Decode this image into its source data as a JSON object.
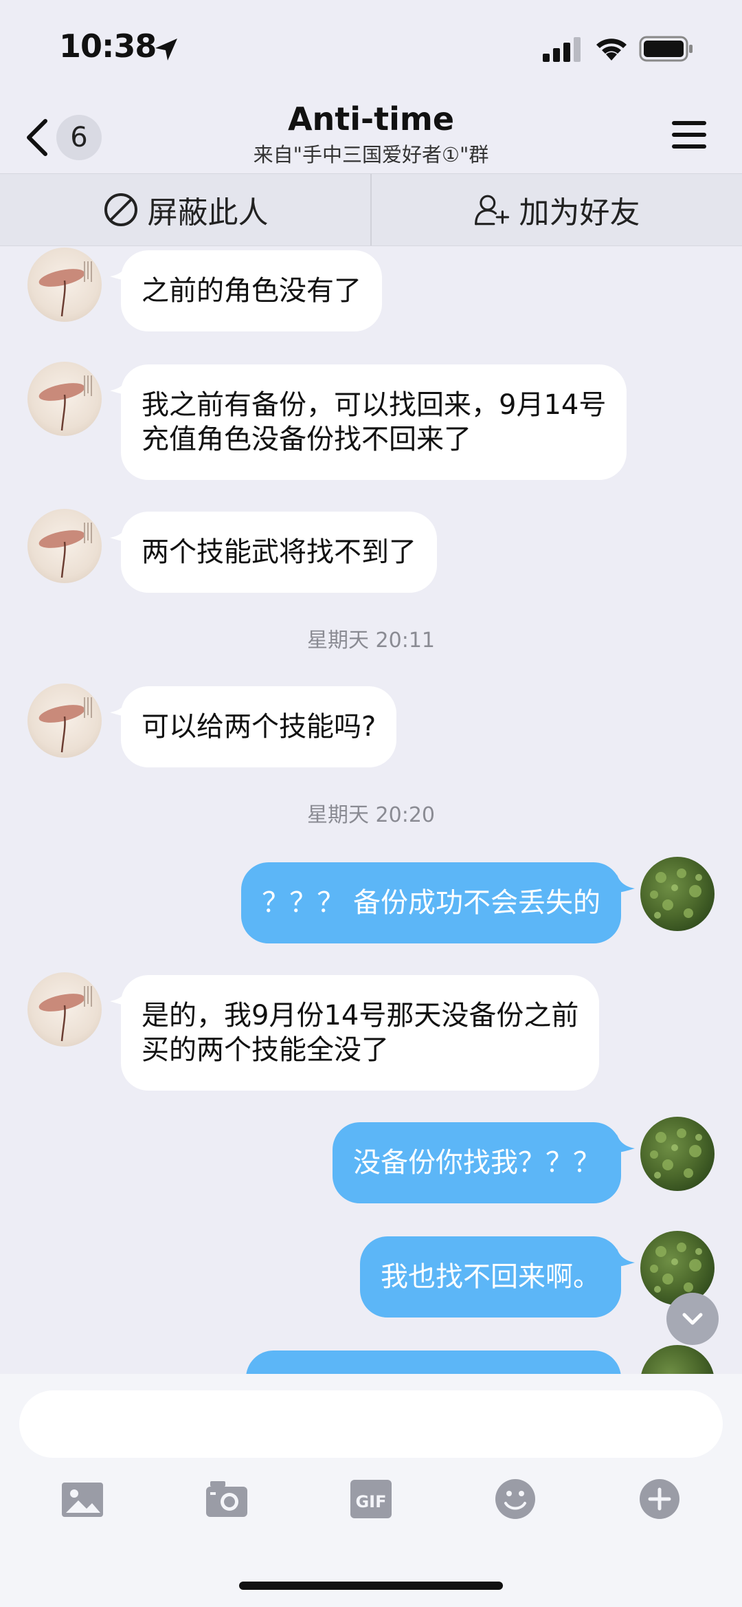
{
  "status_bar": {
    "time": "10:38"
  },
  "nav": {
    "back_count": "6",
    "title": "Anti-time",
    "subtitle": "来自\"手中三国爱好者①\"群"
  },
  "actions": {
    "block_label": "屏蔽此人",
    "add_friend_label": "加为好友"
  },
  "messages": [
    {
      "side": "in",
      "text": "之前的角色没有了"
    },
    {
      "side": "in",
      "lines": [
        "我之前有备份，可以找回来，9月14号",
        "充值角色没备份找不回来了"
      ]
    },
    {
      "side": "in",
      "text": "两个技能武将找不到了"
    },
    {
      "timestamp": "星期天 20:11"
    },
    {
      "side": "in",
      "text": "可以给两个技能吗?"
    },
    {
      "timestamp": "星期天 20:20"
    },
    {
      "side": "out",
      "text": "？？？ 备份成功不会丢失的"
    },
    {
      "side": "in",
      "lines": [
        "是的，我9月份14号那天没备份之前",
        "买的两个技能全没了"
      ]
    },
    {
      "side": "out",
      "text": "没备份你找我？？？"
    },
    {
      "side": "out",
      "text": "我也找不回来啊。"
    }
  ],
  "input": {
    "placeholder": ""
  },
  "colors": {
    "outgoing_bubble": "#5cb6f7",
    "incoming_bubble": "#ffffff",
    "background": "#ededf5"
  }
}
